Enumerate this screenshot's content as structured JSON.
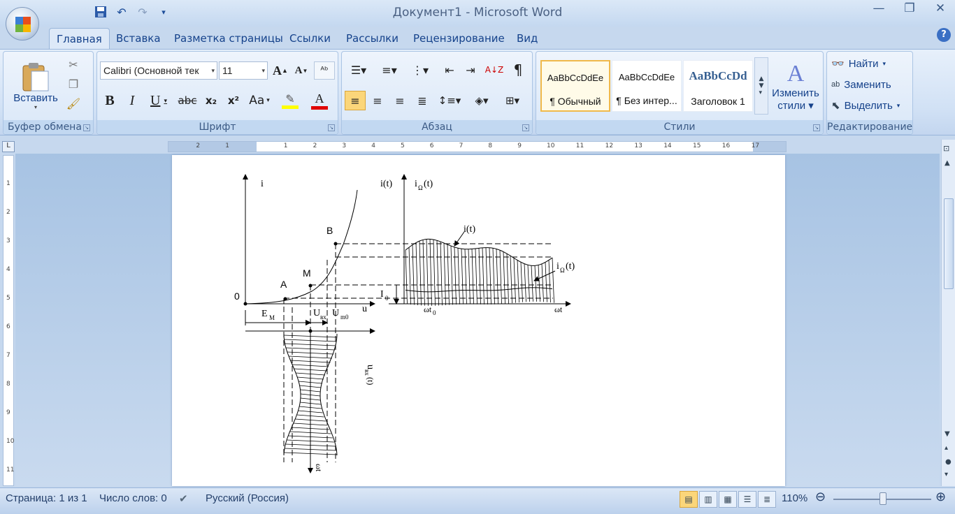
{
  "window": {
    "title": "Документ1 - Microsoft Word"
  },
  "qat": {
    "save_icon": "save-icon",
    "undo_icon": "undo-icon",
    "redo_icon": "redo-icon",
    "customize_icon": "customize-qat-icon"
  },
  "tabs": [
    "Главная",
    "Вставка",
    "Разметка страницы",
    "Ссылки",
    "Рассылки",
    "Рецензирование",
    "Вид"
  ],
  "ribbon": {
    "clipboard": {
      "label": "Буфер обмена",
      "paste": "Вставить"
    },
    "font": {
      "label": "Шрифт",
      "family": "Calibri (Основной тек",
      "size": "11",
      "bold": "B",
      "italic": "I",
      "underline": "U",
      "strike": "abc",
      "sub": "x₂",
      "sup": "x²",
      "case": "Aa",
      "grow": "A",
      "shrink": "A",
      "highlight_color": "#ffff00",
      "font_color": "#e00000"
    },
    "paragraph": {
      "label": "Абзац",
      "pilcrow": "¶"
    },
    "styles": {
      "label": "Стили",
      "items": [
        {
          "preview": "AaBbCcDdEe",
          "name": "¶ Обычный"
        },
        {
          "preview": "AaBbCcDdEe",
          "name": "¶ Без интер..."
        },
        {
          "preview": "AaBbCcDd",
          "name": "Заголовок 1"
        }
      ],
      "change_line1": "Изменить",
      "change_line2": "стили"
    },
    "editing": {
      "label": "Редактирование",
      "find": "Найти",
      "replace": "Заменить",
      "select": "Выделить"
    }
  },
  "figure": {
    "left_axis_y": "i",
    "origin": "0",
    "point_a": "A",
    "point_m": "M",
    "point_b": "B",
    "u_axis": "u",
    "em": "E",
    "em_sub": "M",
    "uvx": "U",
    "uvx_sub": "вх",
    "um0": "U",
    "um0_sub": "m0",
    "uvx_t": "u",
    "uvx_t_sub": "вх",
    "uvx_t_arg": "(t)",
    "omega_t_down": "ωt",
    "right_axis_i": "i(t)",
    "right_axis_iomega": "i",
    "iomega_sub": "Ω",
    "iomega_arg": "(t)",
    "curve_i": "i(t)",
    "curve_iomega": "i",
    "curve_iomega_sub": "Ω",
    "curve_iomega_arg": "(t)",
    "i0": "I",
    "i0_sub": "0",
    "omega_t0": "ωt",
    "omega_t0_sub": "0",
    "omega_t": "ωt"
  },
  "status": {
    "page": "Страница: 1 из 1",
    "words": "Число слов: 0",
    "language": "Русский (Россия)",
    "zoom": "110%"
  }
}
